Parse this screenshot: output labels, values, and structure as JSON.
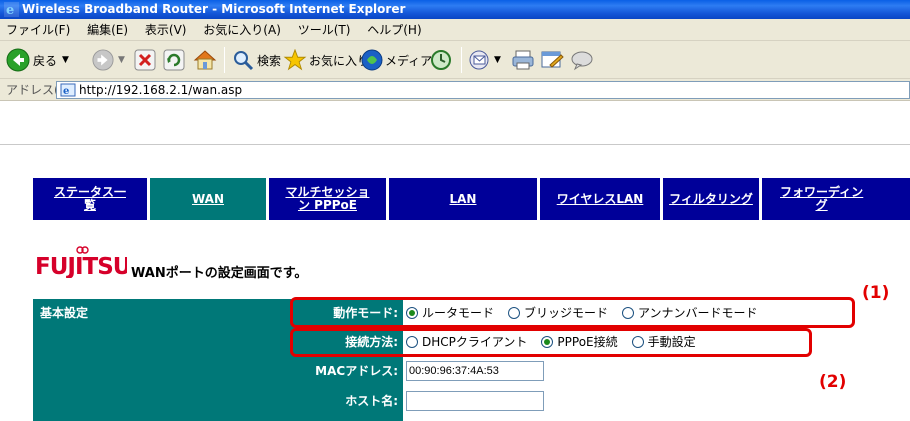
{
  "window": {
    "title": "Wireless Broadband Router - Microsoft Internet Explorer"
  },
  "menu": [
    "ファイル(F)",
    "編集(E)",
    "表示(V)",
    "お気に入り(A)",
    "ツール(T)",
    "ヘルプ(H)"
  ],
  "toolbar": {
    "back_label": "戻る",
    "search_label": "検索",
    "favorites_label": "お気に入り",
    "media_label": "メディア"
  },
  "address": {
    "label": "アドレス(D)",
    "url": "http://192.168.2.1/wan.asp"
  },
  "nav": [
    {
      "label_line1": "ステータス一",
      "label_line2": "覧"
    },
    {
      "label_line1": "WAN",
      "label_line2": ""
    },
    {
      "label_line1": "マルチセッショ",
      "label_line2": "ン PPPoE"
    },
    {
      "label_line1": "LAN",
      "label_line2": ""
    },
    {
      "label_line1": "ワイヤレスLAN",
      "label_line2": ""
    },
    {
      "label_line1": "フィルタリング",
      "label_line2": ""
    },
    {
      "label_line1": "フォワーディン",
      "label_line2": "グ"
    }
  ],
  "logo": {
    "text": "FUJITSU"
  },
  "page": {
    "heading": "WANポートの設定画面です。"
  },
  "settings": {
    "section_title": "基本設定",
    "mode": {
      "label": "動作モード:",
      "options": [
        "ルータモード",
        "ブリッジモード",
        "アンナンバードモード"
      ],
      "selected": "ルータモード"
    },
    "connection": {
      "label": "接続方法:",
      "options": [
        "DHCPクライアント",
        "PPPoE接続",
        "手動設定"
      ],
      "selected": "PPPoE接続"
    },
    "mac": {
      "label": "MACアドレス:",
      "value": "00:90:96:37:4A:53"
    },
    "host": {
      "label": "ホスト名:",
      "value": ""
    }
  },
  "callouts": {
    "c1": "(1)",
    "c2": "(2)"
  },
  "colors": {
    "nav_bg": "#000099",
    "nav_active": "#007878",
    "section_bg": "#007878",
    "callout": "#e20000",
    "brand": "#d6002a"
  }
}
